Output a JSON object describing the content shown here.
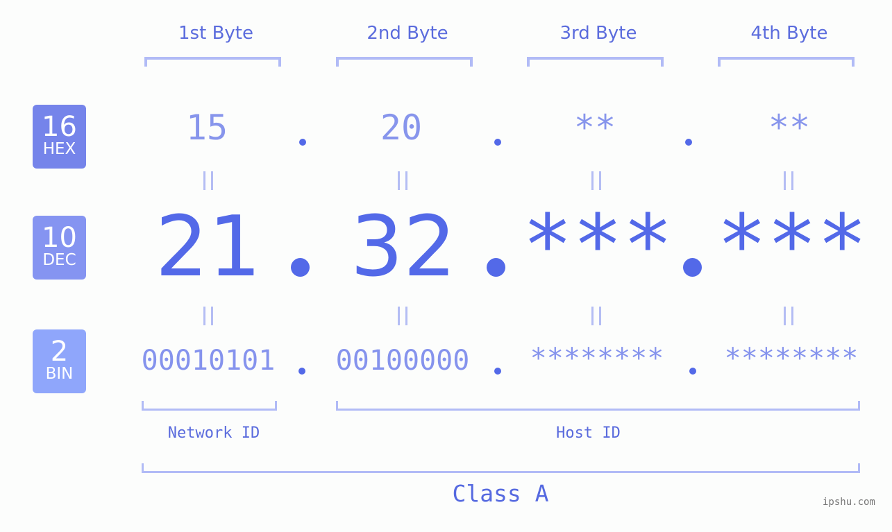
{
  "bytes": [
    {
      "label": "1st Byte",
      "hex": "15",
      "dec": "21",
      "bin": "00010101"
    },
    {
      "label": "2nd Byte",
      "hex": "20",
      "dec": "32",
      "bin": "00100000"
    },
    {
      "label": "3rd Byte",
      "hex": "**",
      "dec": "***",
      "bin": "********"
    },
    {
      "label": "4th Byte",
      "hex": "**",
      "dec": "***",
      "bin": "********"
    }
  ],
  "bases": {
    "hex": {
      "num": "16",
      "label": "HEX",
      "color": "#7584ea"
    },
    "dec": {
      "num": "10",
      "label": "DEC",
      "color": "#8594f1"
    },
    "bin": {
      "num": "2",
      "label": "BIN",
      "color": "#8fa6fb"
    }
  },
  "segments": {
    "network": "Network ID",
    "host": "Host ID"
  },
  "ip_class": "Class A",
  "watermark": "ipshu.com",
  "colors": {
    "accent": "#5369e8",
    "bracket": "#b1bbf6",
    "background": "#fcfdfc"
  }
}
